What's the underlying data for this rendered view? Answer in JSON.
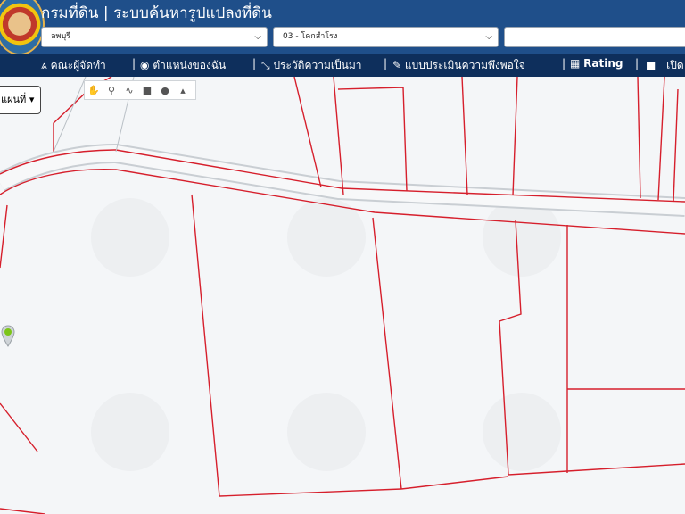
{
  "header": {
    "title": "กรมที่ดิน | ระบบค้นหารูปแปลงที่ดิน",
    "province_select": {
      "value": "ลพบุรี"
    },
    "district_select": {
      "value": "03 - โคกสำโรง"
    },
    "parcel_input": {
      "value": ""
    }
  },
  "nav": {
    "items": [
      {
        "label": "คณะผู้จัดทำ",
        "icon": "antenna-icon"
      },
      {
        "label": "ตำแหน่งของฉัน",
        "icon": "globe-icon"
      },
      {
        "label": "ประวัติความเป็นมา",
        "icon": "tools-icon"
      },
      {
        "label": "แบบประเมินความพึงพอใจ",
        "icon": "edit-icon"
      },
      {
        "label": "Rating",
        "icon": "chart-icon"
      },
      {
        "label": "เปิด",
        "icon": "square-icon"
      }
    ]
  },
  "map": {
    "layer_button": "แผนที่",
    "tools": [
      "hand-icon",
      "pin-icon",
      "line-icon",
      "square-icon",
      "circle-icon",
      "polygon-icon"
    ],
    "parcel_color": "#d61f2c",
    "road_color": "#c9ced3"
  }
}
